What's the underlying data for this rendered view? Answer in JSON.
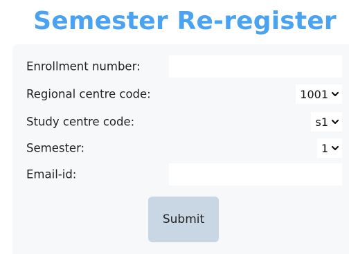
{
  "page": {
    "title": "Semester Re-register"
  },
  "form": {
    "enrollment": {
      "label": "Enrollment number:",
      "value": "",
      "placeholder": ""
    },
    "regional_centre": {
      "label": "Regional centre code:",
      "selected": "1001"
    },
    "study_centre": {
      "label": "Study centre code:",
      "selected": "s1"
    },
    "semester": {
      "label": "Semester:",
      "selected": "1"
    },
    "email": {
      "label": "Email-id:",
      "value": "",
      "placeholder": ""
    },
    "submit_label": "Submit"
  },
  "icons": {
    "dropdown": "chevron-down-icon"
  }
}
